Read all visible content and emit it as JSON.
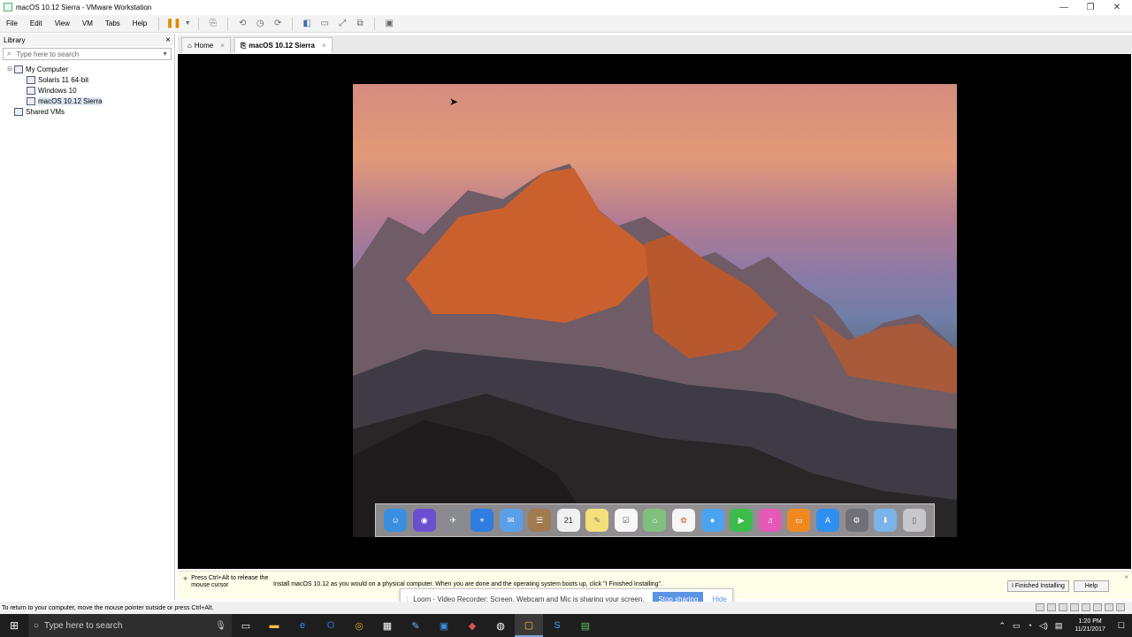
{
  "window": {
    "title": "macOS 10.12 Sierra - VMware Workstation",
    "controls": [
      "—",
      "❐",
      "✕"
    ]
  },
  "menubar": {
    "items": [
      "File",
      "Edit",
      "View",
      "VM",
      "Tabs",
      "Help"
    ]
  },
  "library": {
    "title": "Library",
    "close": "×",
    "search_placeholder": "Type here to search",
    "tree": {
      "my_computer": "My Computer",
      "vms": [
        "Solaris 11 64-bit",
        "Windows 10",
        "macOS 10.12 Sierra"
      ],
      "shared": "Shared VMs"
    }
  },
  "tabs": [
    {
      "label": "Home",
      "close": "×"
    },
    {
      "label": "macOS 10.12 Sierra",
      "close": "×"
    }
  ],
  "dock": {
    "apps": [
      {
        "icon": "finder-icon",
        "glyph": "☺",
        "color": "#3b8fe0"
      },
      {
        "icon": "siri-icon",
        "glyph": "◉",
        "color": "#6a4fd0"
      },
      {
        "icon": "launchpad-icon",
        "glyph": "✈",
        "color": "#8a8a92"
      },
      {
        "icon": "safari-icon",
        "glyph": "⌖",
        "color": "#2f7de0"
      },
      {
        "icon": "mail-icon",
        "glyph": "✉",
        "color": "#5aa0e8"
      },
      {
        "icon": "contacts-icon",
        "glyph": "☰",
        "color": "#a07a50"
      },
      {
        "icon": "calendar-icon",
        "glyph": "21",
        "color": "#f0f0f0"
      },
      {
        "icon": "notes-icon",
        "glyph": "✎",
        "color": "#f4e07a"
      },
      {
        "icon": "reminders-icon",
        "glyph": "☑",
        "color": "#f7f7f7"
      },
      {
        "icon": "maps-icon",
        "glyph": "⌂",
        "color": "#7fc07f"
      },
      {
        "icon": "photos-icon",
        "glyph": "✿",
        "color": "#f5f5f5"
      },
      {
        "icon": "messages-icon",
        "glyph": "💬",
        "color": "#4aa3f0"
      },
      {
        "icon": "facetime-icon",
        "glyph": "▶",
        "color": "#3cbd4a"
      },
      {
        "icon": "itunes-icon",
        "glyph": "♫",
        "color": "#e45ab5"
      },
      {
        "icon": "ibooks-icon",
        "glyph": "▭",
        "color": "#f08a20"
      },
      {
        "icon": "app-store-icon",
        "glyph": "A",
        "color": "#2f8ff0"
      },
      {
        "icon": "system-preferences-icon",
        "glyph": "⚙",
        "color": "#707078"
      },
      {
        "icon": "downloads-folder-icon",
        "glyph": "⬇",
        "color": "#7ab4e8"
      },
      {
        "icon": "trash-icon",
        "glyph": "🗑",
        "color": "#c8c8cc"
      }
    ]
  },
  "hintbar": {
    "release": "Press Ctrl+Alt to release the mouse cursor",
    "message": "Install macOS 10.12 as you would on a physical computer. When you are done and the operating system boots up, click \"I Finished Installing\".",
    "finished_button": "I Finished Installing",
    "help_button": "Help",
    "close": "×"
  },
  "loom": {
    "grip": "⁞",
    "message": "Loom - Video Recorder: Screen, Webcam and Mic is sharing your screen.",
    "stop": "Stop sharing",
    "hide": "Hide"
  },
  "statusbar": {
    "text": "To return to your computer, move the mouse pointer outside or press Ctrl+Alt."
  },
  "taskbar": {
    "search_placeholder": "Type here to search",
    "time": "1:20 PM",
    "date": "11/21/2017"
  }
}
